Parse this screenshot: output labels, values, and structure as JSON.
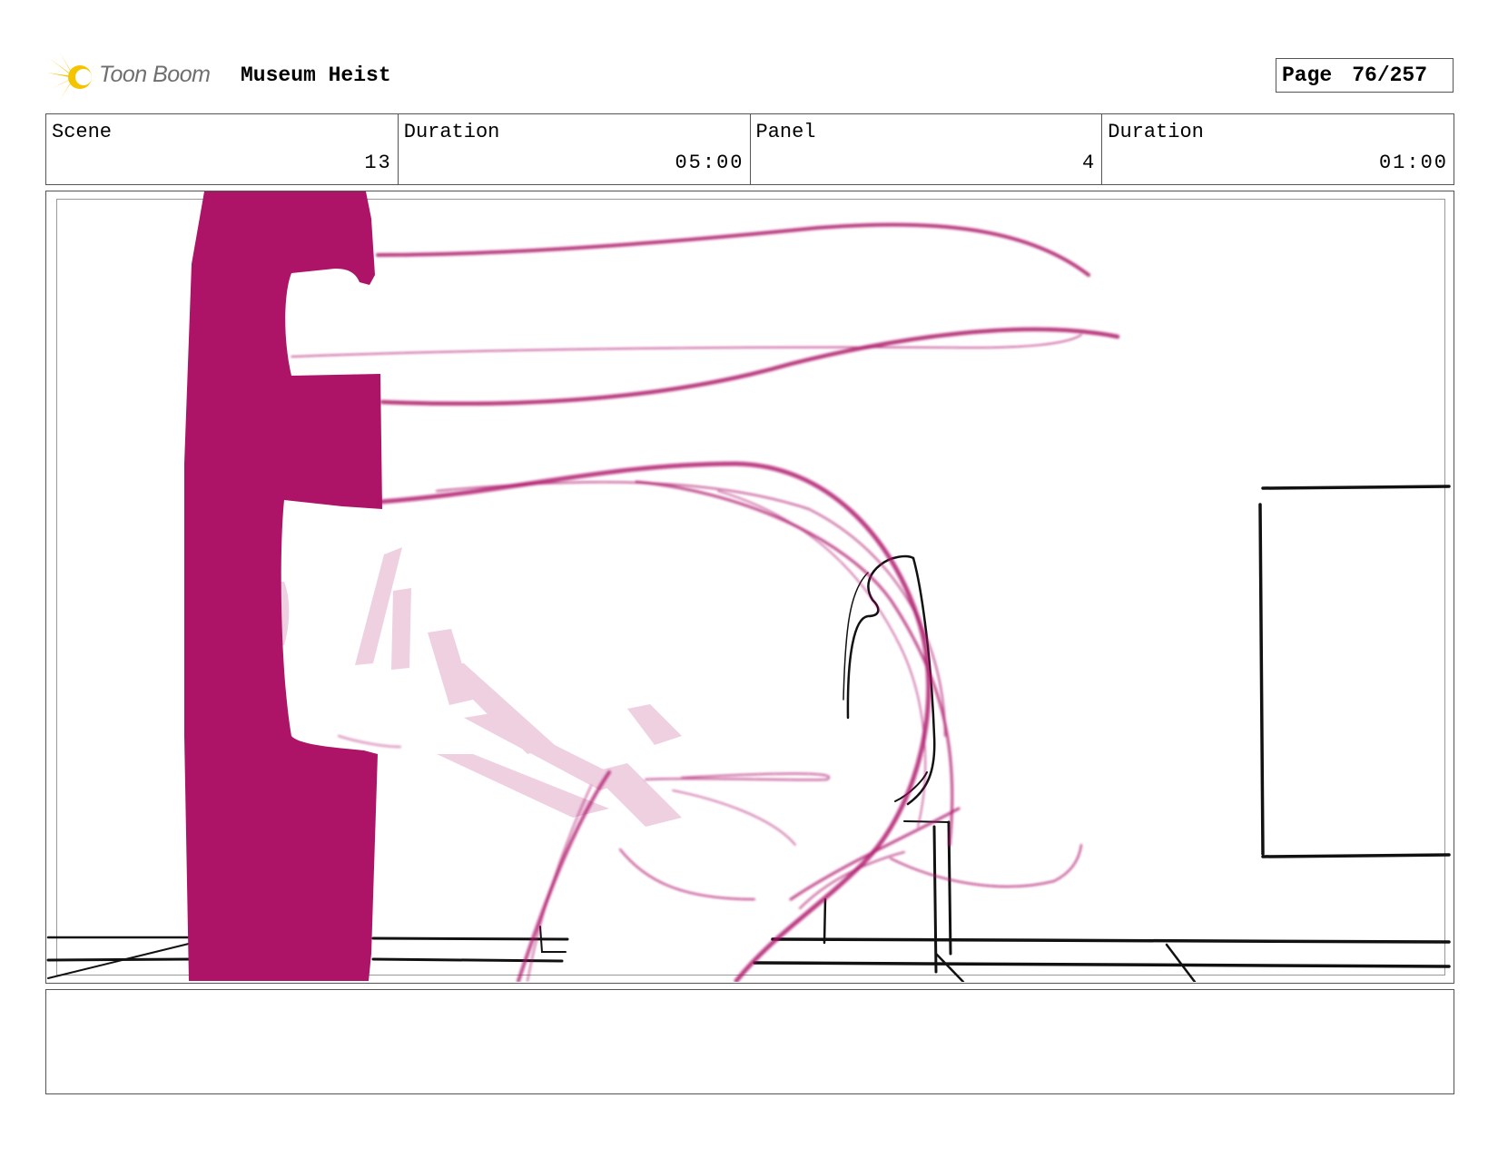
{
  "header": {
    "logo_text": "Toon Boom",
    "project_title": "Museum Heist",
    "page_label": "Page",
    "page_value": "76/257"
  },
  "info": {
    "scene_label": "Scene",
    "scene_value": "13",
    "scene_duration_label": "Duration",
    "scene_duration_value": "05:00",
    "panel_label": "Panel",
    "panel_value": "4",
    "panel_duration_label": "Duration",
    "panel_duration_value": "01:00"
  },
  "notes": {
    "text": ""
  },
  "colors": {
    "sketch_magenta": "#ad1468",
    "line_black": "#111111",
    "logo_yellow": "#f5c400"
  }
}
